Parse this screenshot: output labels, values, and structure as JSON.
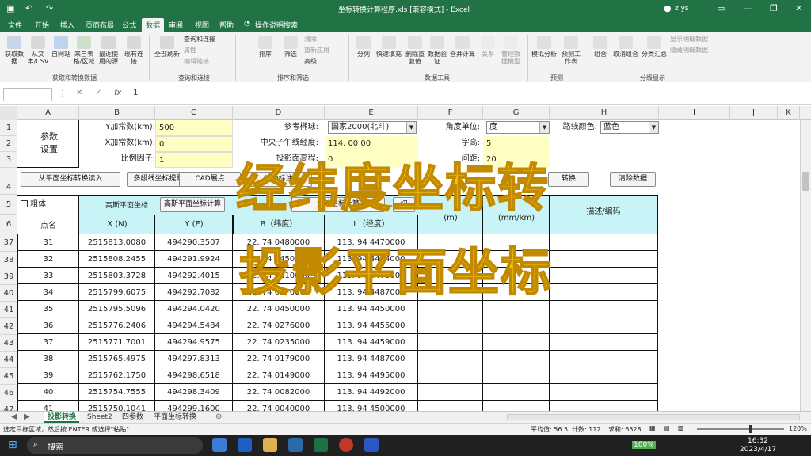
{
  "window": {
    "title": "坐标转换计算程序.xls [兼容模式] - Excel",
    "user": "z ys"
  },
  "menu": [
    "文件",
    "开始",
    "插入",
    "页面布局",
    "公式",
    "数据",
    "审阅",
    "视图",
    "帮助",
    "操作说明搜索"
  ],
  "ribbon": {
    "groups": [
      {
        "name": "获取和转换数据",
        "items": [
          "获取数据",
          "从文本/CSV",
          "自网站",
          "来自表格/区域",
          "最近使用的源",
          "现有连接"
        ]
      },
      {
        "name": "查询和连接",
        "items": [
          "全部刷新",
          "查询和连接",
          "属性",
          "编辑链接"
        ]
      },
      {
        "name": "排序和筛选",
        "items": [
          "排序",
          "筛选",
          "清除",
          "重新应用",
          "高级"
        ]
      },
      {
        "name": "数据工具",
        "items": [
          "分列",
          "快速填充",
          "删除重复值",
          "数据验证",
          "合并计算",
          "关系",
          "管理数据模型"
        ]
      },
      {
        "name": "预测",
        "items": [
          "模拟分析",
          "预测工作表"
        ]
      },
      {
        "name": "分级显示",
        "items": [
          "组合",
          "取消组合",
          "分类汇总",
          "显示明细数据",
          "隐藏明细数据"
        ]
      }
    ]
  },
  "formula_bar": {
    "name_box": "",
    "fx": "fx",
    "value": "1"
  },
  "columns": [
    "A",
    "B",
    "C",
    "D",
    "E",
    "F",
    "G",
    "H",
    "I",
    "J",
    "K"
  ],
  "params": {
    "group_label": "参数设置",
    "y_const_label": "Y加常数(km):",
    "y_const": "500",
    "x_const_label": "X加常数(km):",
    "x_const": "0",
    "scale_label": "比例因子:",
    "scale": "1",
    "ellipsoid_label": "参考椭球:",
    "ellipsoid": "国家2000(北斗)",
    "meridian_label": "中央子午线经度:",
    "meridian": "114. 00 00",
    "proj_height_label": "投影面高程:",
    "proj_height": "0",
    "angle_unit_label": "角度单位:",
    "angle_unit": "度",
    "font_size_label": "字高:",
    "font_size": "5",
    "spacing_label": "间距:",
    "spacing": "20",
    "line_color_label": "路线颜色:",
    "line_color": "蓝色"
  },
  "buttons": {
    "read_plane": "从平面坐标转换读入",
    "polyline_extract": "多段线坐标提取",
    "cad_points": "CAD展点",
    "cad_annot": "CAD标注",
    "convert": "转换",
    "clear": "清除数据",
    "gauss_calc": "高斯平面坐标计算",
    "geo_calc": "大地坐标计算",
    "cut": "切"
  },
  "table": {
    "bold_label": "粗体",
    "point_label": "点名",
    "gauss_header": "高斯平面坐标",
    "x_header": "X (N)",
    "y_header": "Y (E)",
    "b_header": "B（纬度）",
    "l_header": "L（经度）",
    "f_header": "(m)",
    "g_header": "(mm/km)",
    "desc_header": "描述/编码",
    "row_numbers": [
      "37",
      "38",
      "39",
      "40",
      "41",
      "42",
      "43",
      "44",
      "45",
      "46",
      "47"
    ],
    "rows": [
      {
        "n": "31",
        "x": "2515813.0080",
        "y": "494290.3507",
        "b": "22. 74 0480000",
        "l": "113. 94 4470000"
      },
      {
        "n": "32",
        "x": "2515808.2455",
        "y": "494291.9924",
        "b": "22. 74 0450000",
        "l": "113. 94 4474000"
      },
      {
        "n": "33",
        "x": "2515803.3728",
        "y": "494292.4015",
        "b": "22. 74 0410000",
        "l": "113. 94 4478000"
      },
      {
        "n": "34",
        "x": "2515799.6075",
        "y": "494292.7082",
        "b": "22. 74 0370000",
        "l": "113. 94 4487000"
      },
      {
        "n": "35",
        "x": "2515795.5096",
        "y": "494294.0420",
        "b": "22. 74 0450000",
        "l": "113. 94 4450000"
      },
      {
        "n": "36",
        "x": "2515776.2406",
        "y": "494294.5484",
        "b": "22. 74 0276000",
        "l": "113. 94 4455000"
      },
      {
        "n": "37",
        "x": "2515771.7001",
        "y": "494294.9575",
        "b": "22. 74 0235000",
        "l": "113. 94 4459000"
      },
      {
        "n": "38",
        "x": "2515765.4975",
        "y": "494297.8313",
        "b": "22. 74 0179000",
        "l": "113. 94 4487000"
      },
      {
        "n": "39",
        "x": "2515762.1750",
        "y": "494298.6518",
        "b": "22. 74 0149000",
        "l": "113. 94 4495000"
      },
      {
        "n": "40",
        "x": "2515754.7555",
        "y": "494298.3409",
        "b": "22. 74 0082000",
        "l": "113. 94 4492000"
      },
      {
        "n": "41",
        "x": "2515750.1041",
        "y": "494299.1600",
        "b": "22. 74 0040000",
        "l": "113. 94 4500000"
      }
    ]
  },
  "overlay": {
    "line1": "经纬度坐标转",
    "line2": "投影平面坐标"
  },
  "sheet_tabs": [
    "投影转换",
    "Sheet2",
    "四参数",
    "平面坐标转换"
  ],
  "status": {
    "left": "选定目标区域，然后按 ENTER 或选择\"粘贴\"",
    "avg": "平均值: 56.5",
    "count": "计数: 112",
    "sum": "求和: 6328",
    "zoom": "120%"
  },
  "taskbar": {
    "search": "搜索",
    "time": "16:32",
    "date": "2023/4/17",
    "battery": "100%"
  },
  "colors": {
    "excel_green": "#217346",
    "yellow_input": "#ffffc4",
    "cyan_header": "#c9f4f7",
    "overlay": "#f5c400"
  }
}
